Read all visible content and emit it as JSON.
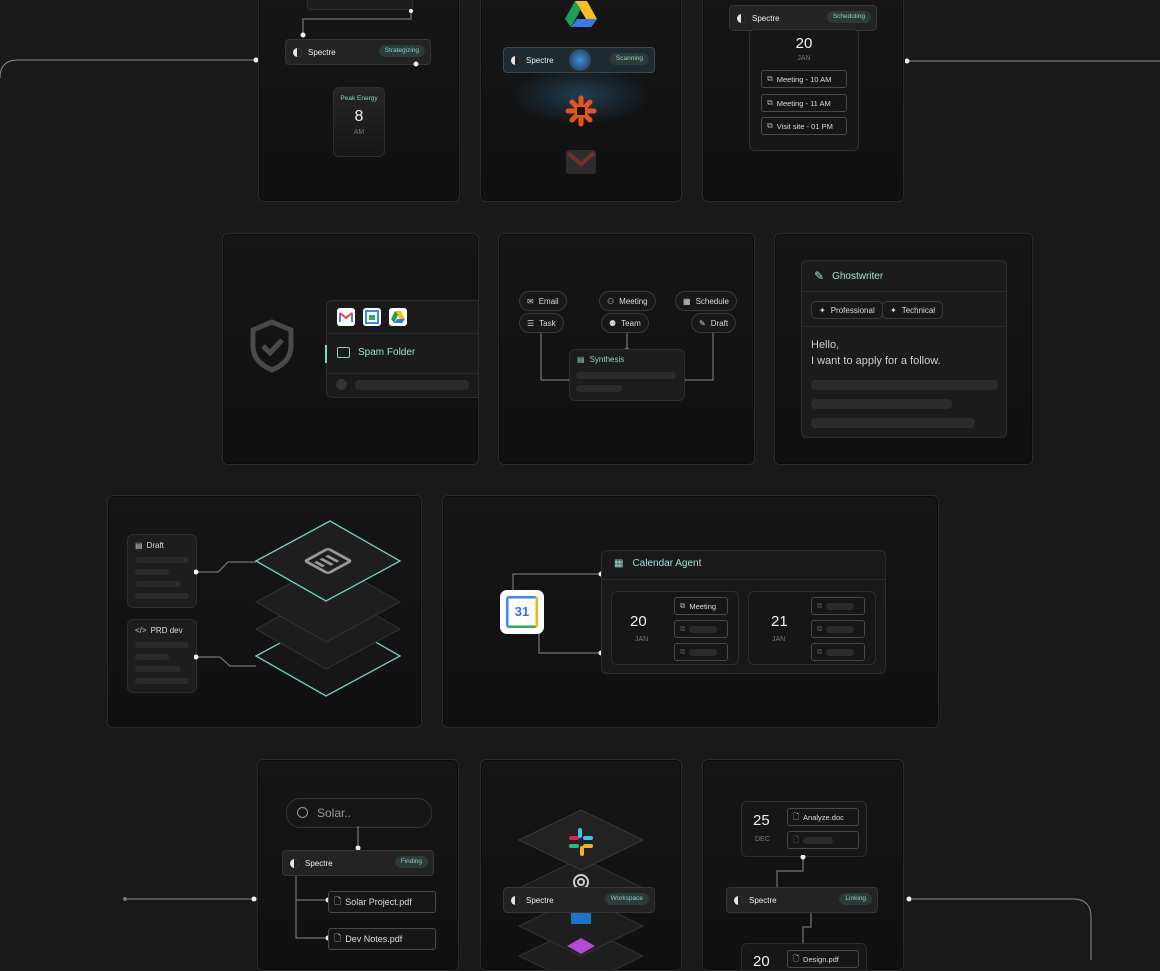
{
  "colors": {
    "background": "#191919",
    "accent": "#7fd8cc",
    "badge_bg": "#2c3a38"
  },
  "row1": {
    "strategize": {
      "agent": "Spectre",
      "status": "Strategizing",
      "energy_label": "Peak Energy",
      "energy_value": "8",
      "energy_unit": "AM"
    },
    "scan": {
      "agent": "Spectre",
      "status": "Scanning",
      "icons": [
        "google-drive-icon",
        "zapier-icon",
        "gmail-icon"
      ]
    },
    "schedule": {
      "agent": "Spectre",
      "status": "Scheduling",
      "day": "20",
      "month": "JAN",
      "events": [
        "Meeting - 10 AM",
        "Meeting - 11 AM",
        "Visit site - 01 PM"
      ]
    }
  },
  "row2": {
    "spam": {
      "folder_label": "Spam Folder",
      "icons": [
        "gmail-icon",
        "google-calendar-icon",
        "google-drive-icon"
      ]
    },
    "synthesis": {
      "sources": [
        "Email",
        "Meeting",
        "Schedule",
        "Task",
        "Team",
        "Draft"
      ],
      "hub_label": "Synthesis"
    },
    "ghostwriter": {
      "title": "Ghostwriter",
      "tones": [
        "Professional",
        "Technical"
      ],
      "greeting": "Hello,",
      "body": "I want to apply for a follow."
    }
  },
  "row3": {
    "layers": {
      "docs": [
        "Draft",
        "PRD dev"
      ]
    },
    "calendar_agent": {
      "title": "Calendar Agent",
      "app_icon_text": "31",
      "days": [
        {
          "day": "20",
          "month": "JAN",
          "first_event": "Meeting"
        },
        {
          "day": "21",
          "month": "JAN",
          "first_event": ""
        }
      ]
    }
  },
  "row4": {
    "finder": {
      "search_value": "Solar..",
      "agent": "Spectre",
      "status": "Finding",
      "files": [
        "Solar Project.pdf",
        "Dev Notes.pdf"
      ]
    },
    "workspace": {
      "agent": "Spectre",
      "status": "Workspace",
      "icons": [
        "slack-icon",
        "openai-icon",
        "app-icon-blue",
        "app-icon-colorful"
      ]
    },
    "linker": {
      "agent": "Spectre",
      "status": "Linking",
      "day_top": "25",
      "month_top": "DEC",
      "file_top": "Analyze.doc",
      "day_bottom": "20",
      "file_bottom": "Design.pdf"
    }
  }
}
